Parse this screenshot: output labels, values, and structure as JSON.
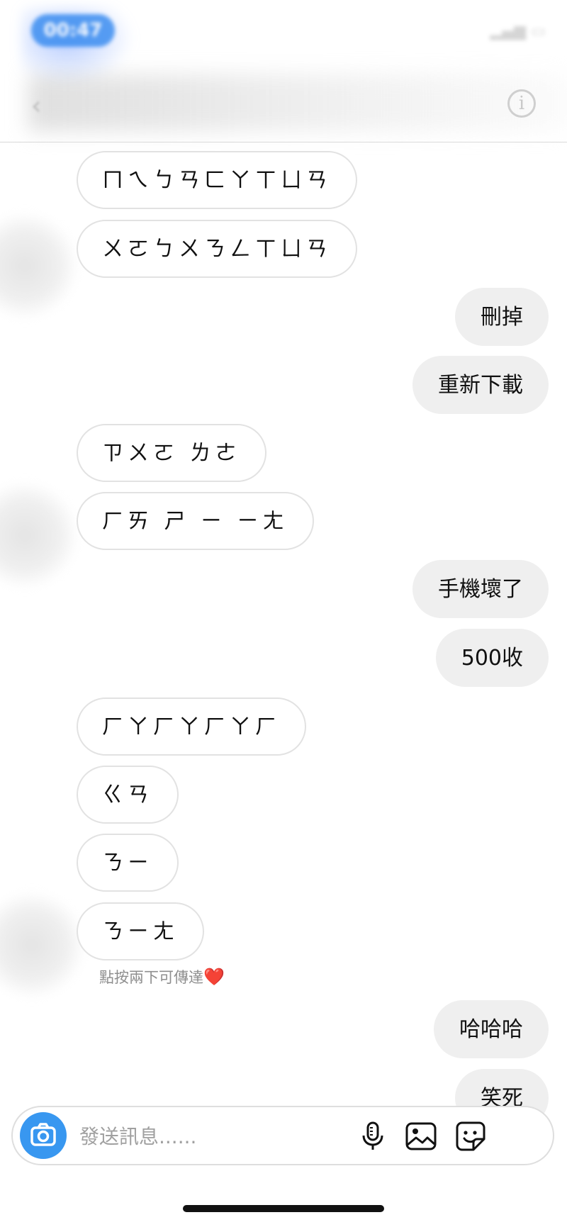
{
  "status_bar": {
    "time": "00:47"
  },
  "messages": [
    {
      "side": "in",
      "text": "ㄇㄟㄅㄢㄈㄚㄒㄩㄢ"
    },
    {
      "side": "in",
      "text": "ㄨㄛㄅㄨㄋㄥㄒㄩㄢ"
    },
    {
      "side": "out",
      "text": "刪掉"
    },
    {
      "side": "out",
      "text": "重新下載"
    },
    {
      "side": "in",
      "text": "ㄗㄨㄛ ㄌㄜ"
    },
    {
      "side": "in",
      "text": "ㄏㄞ ㄕ ㄧ ㄧㄤ"
    },
    {
      "side": "out",
      "text": "手機壞了"
    },
    {
      "side": "out",
      "text": "500收"
    },
    {
      "side": "in",
      "text": "ㄏㄚㄏㄚㄏㄚㄏ"
    },
    {
      "side": "in",
      "text": "ㄍㄢ"
    },
    {
      "side": "in",
      "text": "ㄋㄧ"
    },
    {
      "side": "in",
      "text": "ㄋㄧㄤ"
    },
    {
      "side": "out",
      "text": "哈哈哈"
    },
    {
      "side": "out",
      "text": "笑死"
    }
  ],
  "like_hint": {
    "text": "點按兩下可傳達",
    "emoji": "❤️"
  },
  "composer": {
    "placeholder": "發送訊息......"
  },
  "icons": {
    "camera": "camera-icon",
    "microphone": "microphone-icon",
    "gallery": "image-icon",
    "sticker": "sticker-icon",
    "info": "info-icon",
    "back": "chevron-left-icon"
  },
  "colors": {
    "accent": "#3897f0",
    "incoming_bubble_border": "#e2e2e2",
    "outgoing_bubble": "#efefef",
    "heart": "#e8222e"
  }
}
